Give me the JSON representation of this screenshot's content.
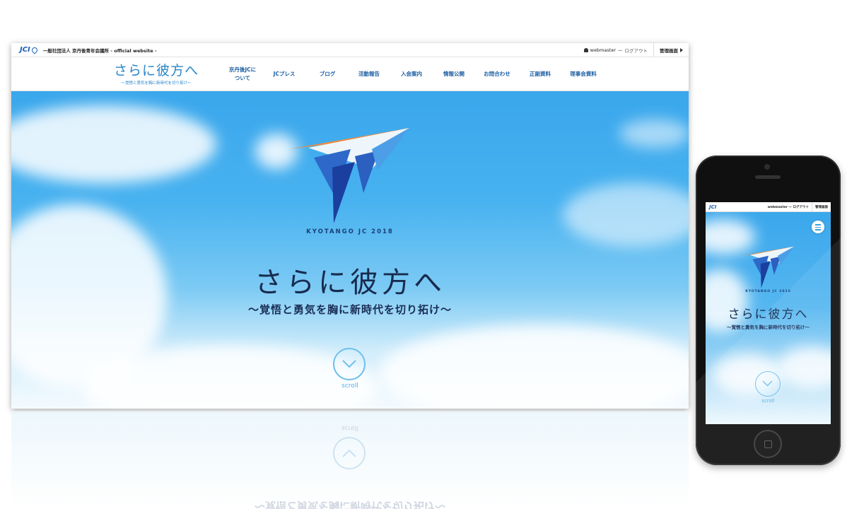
{
  "topbar": {
    "logo_text": "JCI",
    "org_name": "一般社団法人 京丹後青年会議所 - official website -",
    "user_name": "webmaster",
    "logout": "ログアウト",
    "admin": "管理画面"
  },
  "brand": {
    "title": "さらに彼方へ",
    "subtitle": "〜覚悟と勇気を胸に新時代を切り拓け〜"
  },
  "nav": {
    "items": [
      {
        "label_line1": "京丹後JCに",
        "label_line2": "ついて"
      },
      {
        "label_line1": "JCプレス",
        "label_line2": ""
      },
      {
        "label_line1": "ブログ",
        "label_line2": ""
      },
      {
        "label_line1": "活動報告",
        "label_line2": ""
      },
      {
        "label_line1": "入会案内",
        "label_line2": ""
      },
      {
        "label_line1": "情報公開",
        "label_line2": ""
      },
      {
        "label_line1": "お問合わせ",
        "label_line2": ""
      },
      {
        "label_line1": "正副資料",
        "label_line2": ""
      },
      {
        "label_line1": "理事会資料",
        "label_line2": ""
      }
    ]
  },
  "hero": {
    "emblem_caption": "KYOTANGO JC 2018",
    "title": "さらに彼方へ",
    "subtitle": "〜覚悟と勇気を胸に新時代を切り拓け〜",
    "scroll_label": "scroll"
  },
  "phone": {
    "logo_text": "JCI",
    "user_text": "webmaster — ログアウト",
    "admin": "管理画面",
    "emblem_caption": "KYOTANGO JC 2018",
    "title": "さらに彼方へ",
    "subtitle": "〜覚悟と勇気を胸に新時代を切り拓け〜",
    "scroll_label": "scroll"
  },
  "colors": {
    "brand_blue": "#2a86c9",
    "nav_blue": "#1d5fa3",
    "sky_top": "#3aa7ec",
    "emblem_orange": "#f08a3a",
    "emblem_navy": "#1a3f9e"
  },
  "icons": [
    "jci-pin-icon",
    "user-icon",
    "arrow-right-icon",
    "chevron-down-icon",
    "menu-icon"
  ]
}
